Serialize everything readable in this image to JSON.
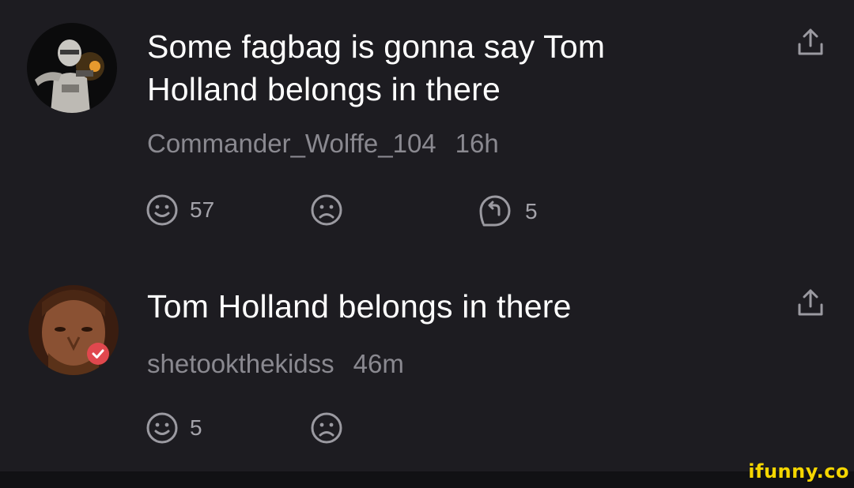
{
  "comments": [
    {
      "text": "Some fagbag is gonna say Tom\nHolland belongs in there",
      "username": "Commander_Wolffe_104",
      "time": "16h",
      "smile_count": "57",
      "reply_count": "5",
      "avatar": "clone-trooper-avatar"
    },
    {
      "text": "Tom Holland belongs in there",
      "username": "shetookthekidss",
      "time": "46m",
      "smile_count": "5",
      "avatar": "bearded-man-avatar",
      "verified_badge": true
    }
  ],
  "icons": {
    "share": "share-icon",
    "smile": "smile-icon",
    "frown": "frown-icon",
    "reply": "reply-icon"
  },
  "watermark": "ifunny.co",
  "colors": {
    "background": "#1d1c21",
    "text": "#ffffff",
    "meta": "#8a8990",
    "icon": "#9b9aa1",
    "badge": "#e0484e",
    "watermark": "#f5d600"
  }
}
